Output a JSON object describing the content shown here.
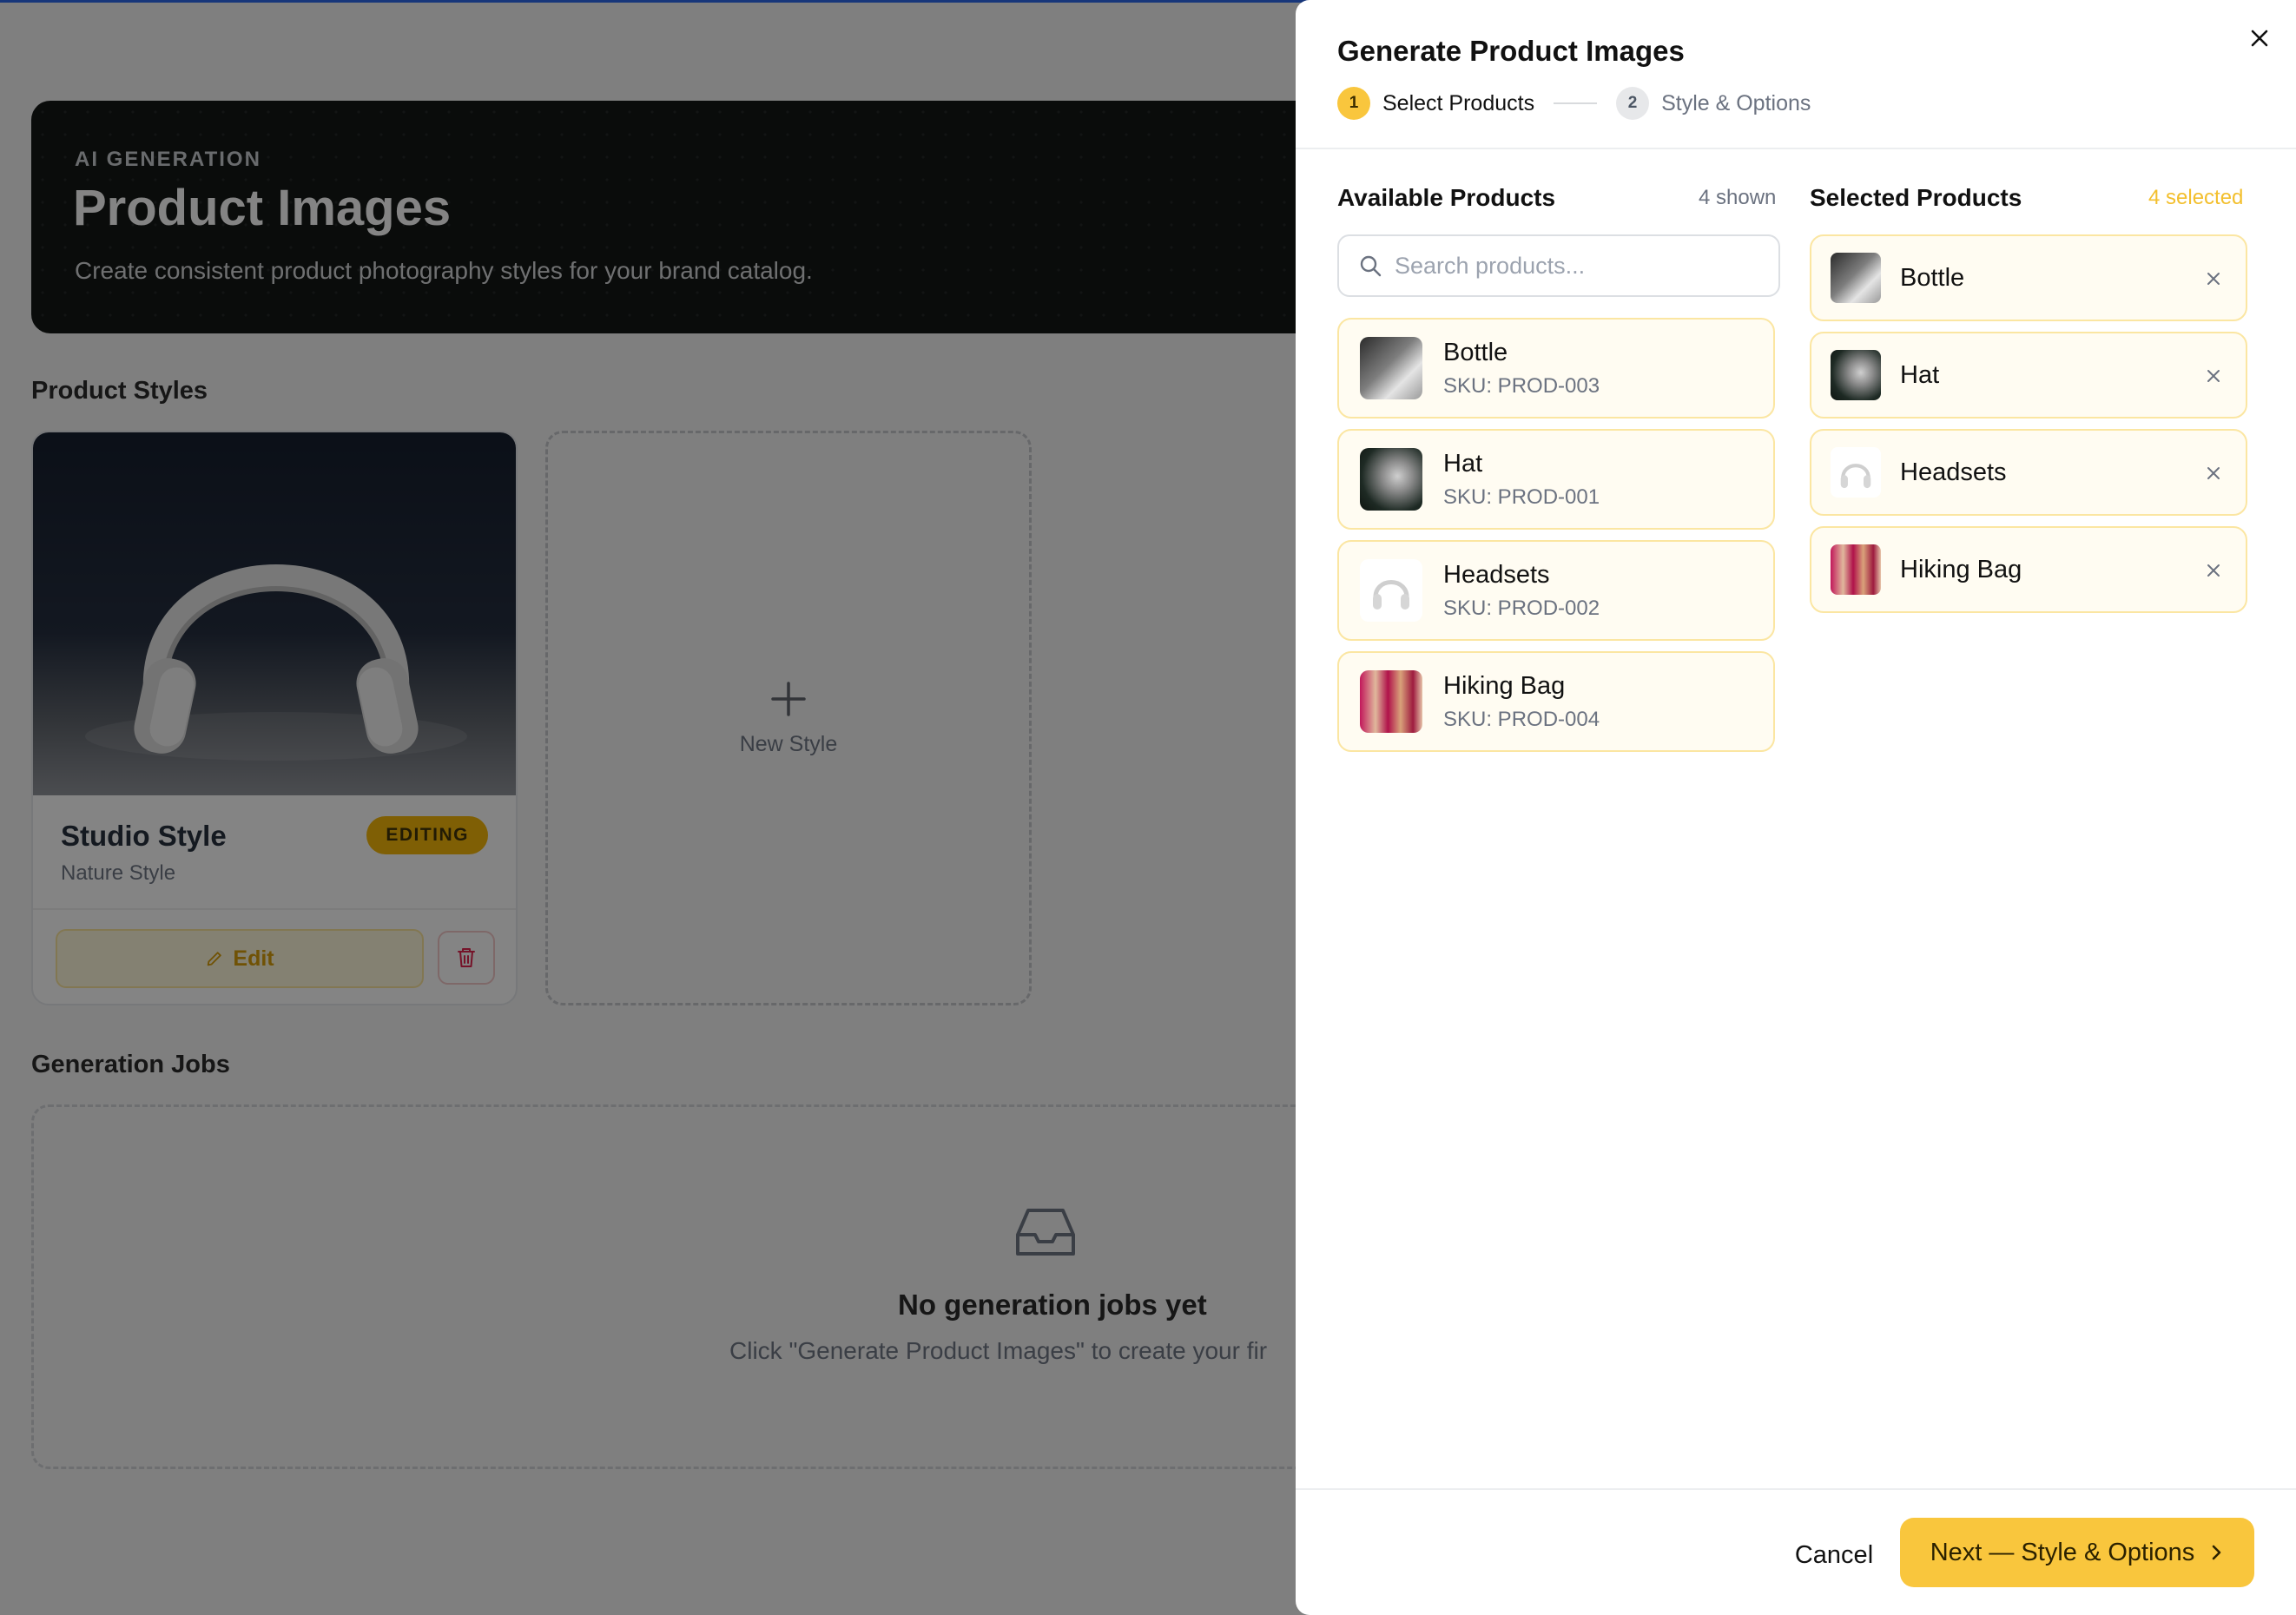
{
  "hero": {
    "eyebrow": "AI GENERATION",
    "title": "Product Images",
    "subtitle": "Create consistent product photography styles for your brand catalog."
  },
  "sections": {
    "product_styles": "Product Styles",
    "generation_jobs": "Generation Jobs"
  },
  "style_card": {
    "name": "Studio Style",
    "subtitle": "Nature Style",
    "badge": "EDITING",
    "edit_label": "Edit"
  },
  "new_style": {
    "label": "New Style"
  },
  "jobs_empty": {
    "title": "No generation jobs yet",
    "subtitle": "Click \"Generate Product Images\" to create your fir"
  },
  "drawer": {
    "title": "Generate Product Images",
    "steps": [
      {
        "num": "1",
        "label": "Select Products"
      },
      {
        "num": "2",
        "label": "Style & Options"
      }
    ],
    "available": {
      "heading": "Available Products",
      "count": "4 shown",
      "search_placeholder": "Search products...",
      "items": [
        {
          "name": "Bottle",
          "sku": "SKU: PROD-003"
        },
        {
          "name": "Hat",
          "sku": "SKU: PROD-001"
        },
        {
          "name": "Headsets",
          "sku": "SKU: PROD-002"
        },
        {
          "name": "Hiking Bag",
          "sku": "SKU: PROD-004"
        }
      ]
    },
    "selected": {
      "heading": "Selected Products",
      "count": "4 selected",
      "items": [
        {
          "name": "Bottle"
        },
        {
          "name": "Hat"
        },
        {
          "name": "Headsets"
        },
        {
          "name": "Hiking Bag"
        }
      ]
    },
    "footer": {
      "cancel_label": "Cancel",
      "next_label": "Next — Style & Options"
    }
  },
  "colors": {
    "accent": "#f9c63d",
    "badge": "#f4b400",
    "overlay": "rgba(10,10,10,0.50)"
  }
}
